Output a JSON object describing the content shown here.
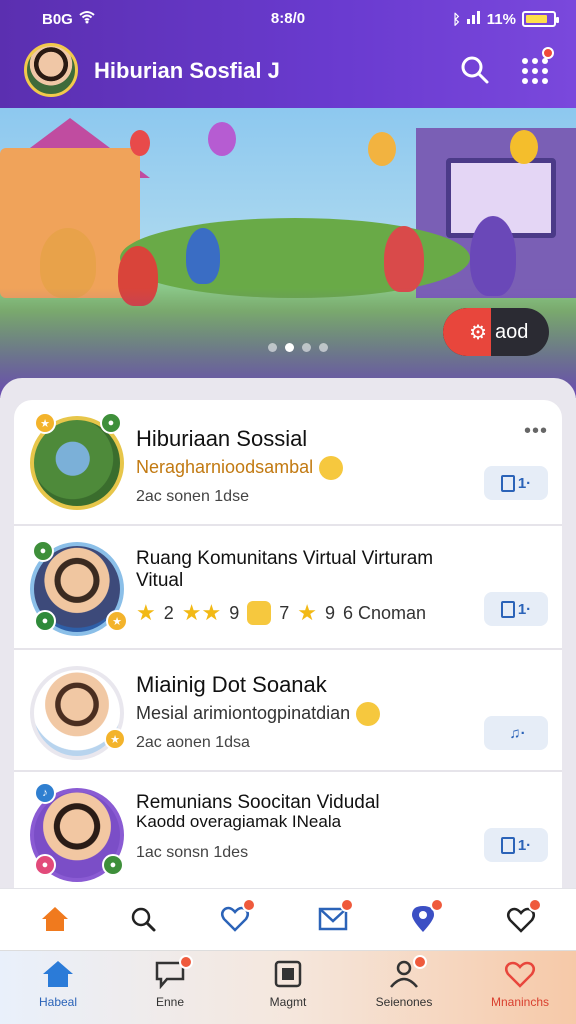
{
  "status_bar": {
    "left": "B0G",
    "time": "8:8/0",
    "right": "11%",
    "battery_level": 0.7
  },
  "header": {
    "title": "Hiburian Sosfial J"
  },
  "banner": {
    "add_label": "aod",
    "slides": 4,
    "active_slide": 1
  },
  "list": [
    {
      "title": "Hiburiaan Sossial",
      "subtitle": "Neragharnioodsambal",
      "meta": "2ac sonen 1dse",
      "action": "1·"
    },
    {
      "title": "Ruang Komunitans Virtual Virturam",
      "title2": "Vitual",
      "ratings": [
        "2",
        "9",
        "7",
        "9"
      ],
      "ratings_tail": "6 Cnoman",
      "action": "1·"
    },
    {
      "title": "Miainig Dot Soanak",
      "subtitle": "Mesial arimiontogpinatdian",
      "meta": "2ac aonen 1dsa",
      "action": "♫·"
    },
    {
      "title": "Remunians Soocitan Vidudal",
      "title2": "Kaodd overagiamak INeala",
      "meta": "1ac sonsn 1des",
      "action": "1·"
    }
  ],
  "nav_icons": [
    "home-icon",
    "search-icon",
    "heart-icon",
    "mail-icon",
    "location-icon",
    "shield-heart-icon"
  ],
  "bottom_nav": [
    {
      "label": "Habeal"
    },
    {
      "label": "Enne"
    },
    {
      "label": "Magmt"
    },
    {
      "label": "Seienones"
    },
    {
      "label": "Mnaninchs"
    }
  ],
  "colors": {
    "header": "#5b2fb0",
    "accent_orange": "#f07a1e",
    "nav_blue": "#2b63b8",
    "badge": "#ef5a3c"
  }
}
